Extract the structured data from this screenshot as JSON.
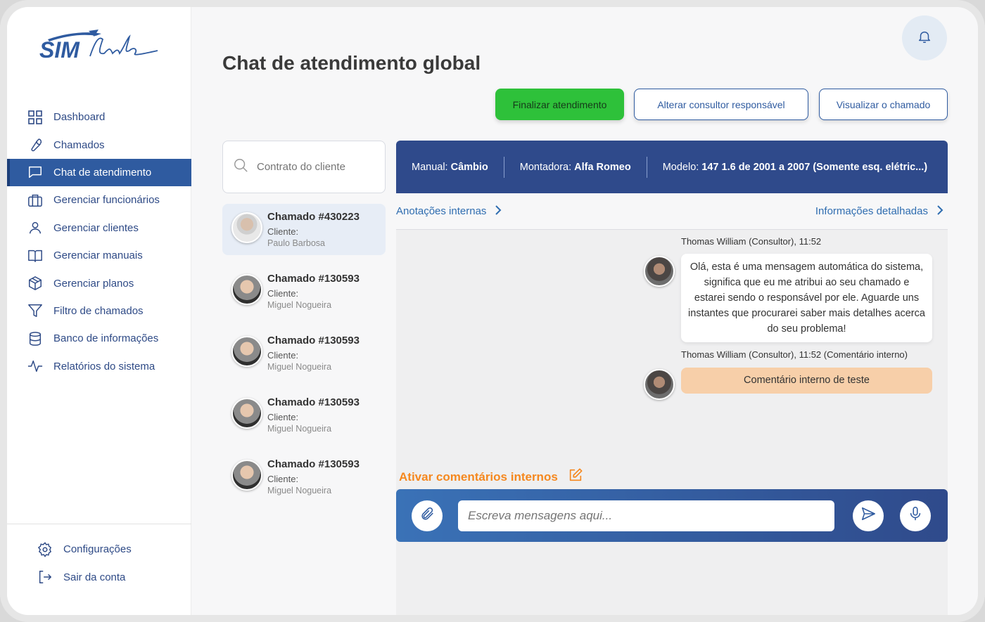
{
  "brand": {
    "logo_text_bold": "SIM",
    "logo_text_script": "Club"
  },
  "sidebar": {
    "items": [
      {
        "label": "Dashboard",
        "icon": "dashboard-icon"
      },
      {
        "label": "Chamados",
        "icon": "wrench-icon"
      },
      {
        "label": "Chat de atendimento",
        "icon": "chat-icon",
        "active": true
      },
      {
        "label": "Gerenciar funcionários",
        "icon": "briefcase-icon"
      },
      {
        "label": "Gerenciar clientes",
        "icon": "user-icon"
      },
      {
        "label": "Gerenciar manuais",
        "icon": "book-icon"
      },
      {
        "label": "Gerenciar planos",
        "icon": "box-icon"
      },
      {
        "label": "Filtro de chamados",
        "icon": "filter-icon"
      },
      {
        "label": "Banco de informações",
        "icon": "database-icon"
      },
      {
        "label": "Relatórios do sistema",
        "icon": "activity-icon"
      }
    ],
    "bottom": [
      {
        "label": "Configurações",
        "icon": "gear-icon"
      },
      {
        "label": "Sair da conta",
        "icon": "logout-icon"
      }
    ]
  },
  "header": {
    "title": "Chat de atendimento global",
    "finalizar_label": "Finalizar atendimento",
    "alterar_label": "Alterar consultor responsável",
    "visualizar_label": "Visualizar o chamado"
  },
  "search": {
    "placeholder": "Contrato do cliente"
  },
  "tickets": [
    {
      "title": "Chamado #430223",
      "label": "Cliente:",
      "name": "Paulo Barbosa",
      "active": true
    },
    {
      "title": "Chamado #130593",
      "label": "Cliente:",
      "name": "Miguel Nogueira"
    },
    {
      "title": "Chamado #130593",
      "label": "Cliente:",
      "name": "Miguel Nogueira"
    },
    {
      "title": "Chamado #130593",
      "label": "Cliente:",
      "name": "Miguel Nogueira"
    },
    {
      "title": "Chamado #130593",
      "label": "Cliente:",
      "name": "Miguel Nogueira"
    }
  ],
  "infobar": {
    "manual_label": "Manual:",
    "manual_value": "Câmbio",
    "montadora_label": "Montadora:",
    "montadora_value": "Alfa Romeo",
    "modelo_label": "Modelo:",
    "modelo_value": "147 1.6 de 2001 a 2007 (Somente esq. elétric...)"
  },
  "subbar": {
    "left": "Anotações internas",
    "right": "Informações detalhadas"
  },
  "messages": [
    {
      "meta": "Thomas William (Consultor), 11:52",
      "text": "Olá, esta é uma mensagem automática do sistema, significa que eu me atribui ao seu chamado e estarei sendo o responsável por ele. Aguarde uns instantes que procurarei saber mais detalhes acerca do seu problema!"
    },
    {
      "meta": "Thomas William (Consultor), 11:52 (Comentário interno)",
      "text": "Comentário interno de teste"
    }
  ],
  "internal_toggle": "Ativar comentários internos",
  "composer": {
    "placeholder": "Escreva mensagens aqui..."
  },
  "colors": {
    "primary": "#2f4a8b",
    "accent_green": "#2ec13a",
    "accent_orange": "#f5881f",
    "internal_bubble": "#f7cfa9"
  }
}
